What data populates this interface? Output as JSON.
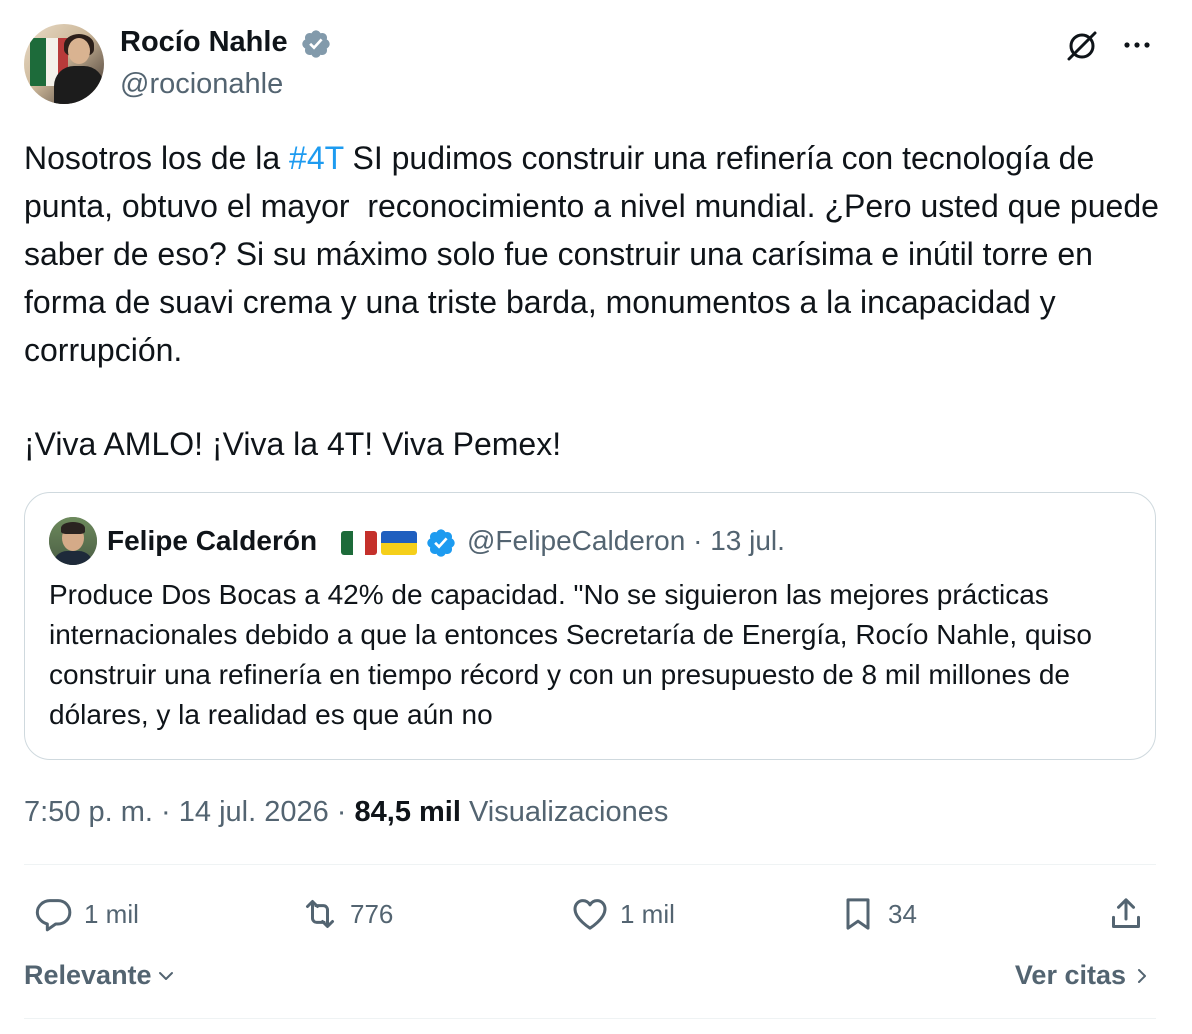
{
  "author": {
    "name": "Rocío Nahle",
    "handle": "@rocionahle"
  },
  "tweet": {
    "text_before": "Nosotros los de la ",
    "hashtag": "#4T",
    "text_after": " SI pudimos construir una refinería con tecnología de punta, obtuvo el mayor  reconocimiento a nivel mundial. ¿Pero usted que puede saber de eso? Si su máximo solo fue construir una carísima e inútil torre en forma de suavi crema y una triste barda, monumentos a la incapacidad y corrupción.",
    "text_line2": "¡Viva AMLO! ¡Viva la 4T! Viva Pemex!"
  },
  "quoted": {
    "name": "Felipe Calderón",
    "handle_date": "@FelipeCalderon · 13 jul.",
    "text": "Produce Dos Bocas a 42% de capacidad. \"No se siguieron las mejores prácticas internacionales debido a que la entonces Secretaría de Energía, Rocío Nahle, quiso construir una refinería en tiempo récord y con un presupuesto de 8 mil millones de dólares, y la realidad es que aún no"
  },
  "meta": {
    "time": "7:50 p. m.",
    "date": "14 jul. 2026",
    "views_count": "84,5 mil",
    "views_label": "Visualizaciones"
  },
  "actions": {
    "replies": "1 mil",
    "reposts": "776",
    "likes": "1 mil",
    "bookmarks": "34"
  },
  "footer": {
    "sort_label": "Relevante",
    "quotes_label": "Ver citas"
  },
  "colors": {
    "accent": "#1d9bf0",
    "text": "#0f1419",
    "secondary": "#536471",
    "border": "#cfd9de"
  },
  "icons": [
    "verified-badge-icon",
    "grok-icon",
    "more-icon",
    "reply-icon",
    "repost-icon",
    "like-icon",
    "bookmark-icon",
    "share-icon",
    "chevron-down-icon",
    "chevron-right-icon"
  ]
}
